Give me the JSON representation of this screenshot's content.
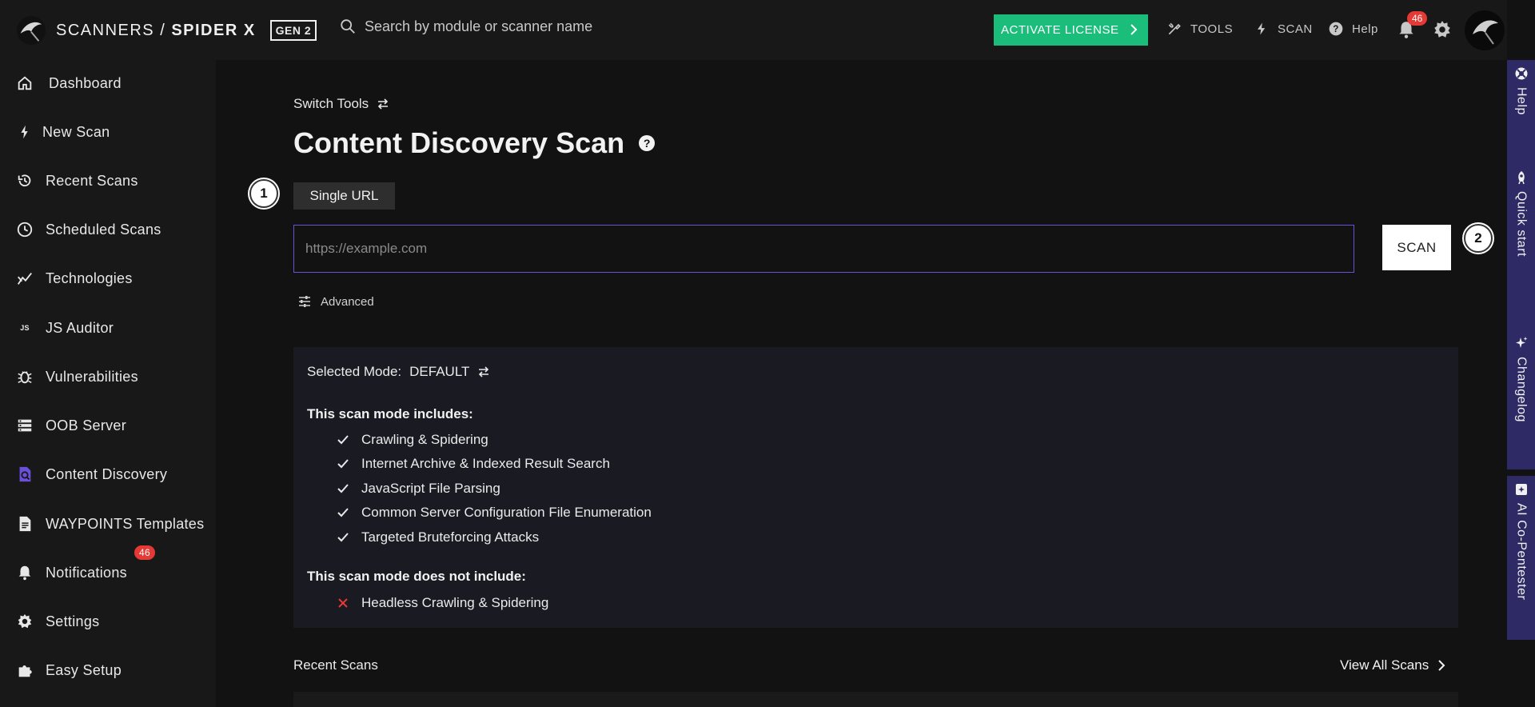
{
  "brand": {
    "product": "SCANNERS / ",
    "name": "SPIDER X",
    "badge": "GEN 2"
  },
  "search": {
    "placeholder": "Search by module or scanner name"
  },
  "topnav": {
    "activate_label": "ACTIVATE LICENSE",
    "tools_label": "TOOLS",
    "scan_label": "SCAN",
    "help_label": "Help",
    "notification_count": "46"
  },
  "sidebar": {
    "items": [
      {
        "label": "Dashboard",
        "icon": "home-icon"
      },
      {
        "label": "New Scan",
        "icon": "bolt-icon"
      },
      {
        "label": "Recent Scans",
        "icon": "history-icon"
      },
      {
        "label": "Scheduled Scans",
        "icon": "clock-icon"
      },
      {
        "label": "Technologies",
        "icon": "chart-icon"
      },
      {
        "label": "JS Auditor",
        "icon": "js-icon",
        "icon_text": "JS"
      },
      {
        "label": "Vulnerabilities",
        "icon": "bug-icon"
      },
      {
        "label": "OOB Server",
        "icon": "server-icon"
      },
      {
        "label": "Content Discovery",
        "icon": "content-search-icon"
      },
      {
        "label": "WAYPOINTS Templates",
        "icon": "document-icon"
      },
      {
        "label": "Notifications",
        "icon": "bell-icon",
        "badge": "46"
      },
      {
        "label": "Settings",
        "icon": "gear-icon"
      },
      {
        "label": "Easy Setup",
        "icon": "puzzle-icon"
      }
    ]
  },
  "main": {
    "switch_tools": "Switch Tools",
    "title": "Content Discovery Scan",
    "help_glyph": "?",
    "step1": "1",
    "step2": "2",
    "tab_single": "Single URL",
    "url_placeholder": "https://example.com",
    "scan_button": "SCAN",
    "advanced": "Advanced",
    "mode": {
      "label": "Selected Mode:",
      "value": "DEFAULT",
      "includes_heading": "This scan mode includes:",
      "includes": [
        "Crawling & Spidering",
        "Internet Archive & Indexed Result Search",
        "JavaScript File Parsing",
        "Common Server Configuration File Enumeration",
        "Targeted Bruteforcing Attacks"
      ],
      "excludes_heading": "This scan mode does not include:",
      "excludes": [
        "Headless Crawling & Spidering"
      ]
    },
    "recent_scans": "Recent Scans",
    "view_all": "View All Scans"
  },
  "rail": {
    "help": "Help",
    "quick_start": "Quick start",
    "changelog": "Changelog",
    "ai": "AI Co-Pentester"
  },
  "colors": {
    "accent_purple": "#6a4fd8",
    "activate_green": "#1bbd7a",
    "badge_red": "#e53935",
    "rail_purple": "#2d2a66"
  }
}
